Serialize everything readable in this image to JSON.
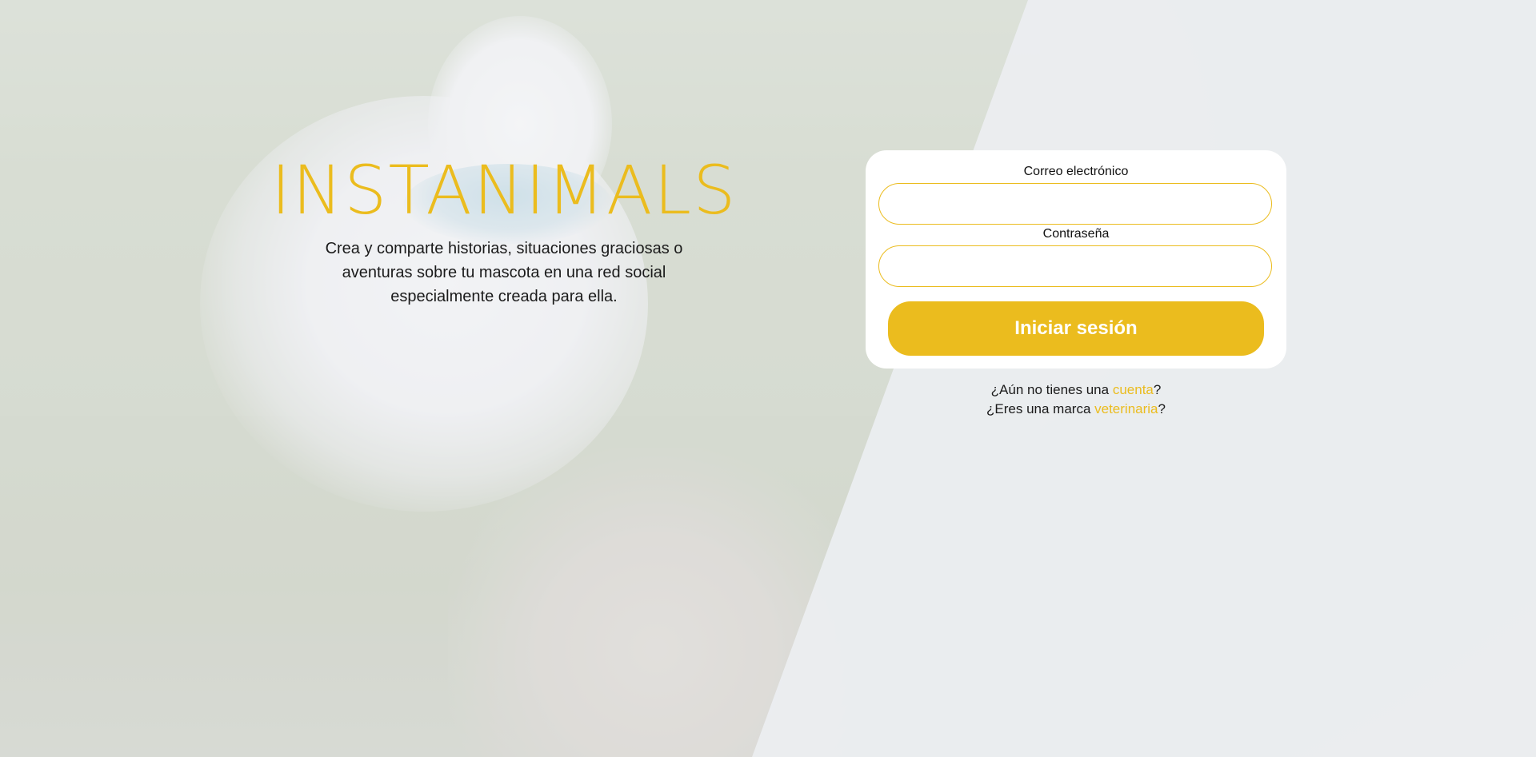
{
  "hero": {
    "brand": "INSTANIMALS",
    "tagline": "Crea y comparte historias, situaciones graciosas o aventuras sobre tu mascota en una red social especialmente creada para ella."
  },
  "login": {
    "email_label": "Correo electrónico",
    "email_value": "",
    "password_label": "Contraseña",
    "password_value": "",
    "submit_label": "Iniciar sesión"
  },
  "links": {
    "signup_prefix": "¿Aún no tienes una ",
    "signup_link": "cuenta",
    "signup_suffix": "?",
    "vet_prefix": "¿Eres una marca ",
    "vet_link": "veterinaria",
    "vet_suffix": "?"
  },
  "colors": {
    "accent": "#ebbc1e",
    "card_bg": "#ffffff",
    "panel_bg": "#eceef1",
    "text": "#1b1b1b"
  }
}
